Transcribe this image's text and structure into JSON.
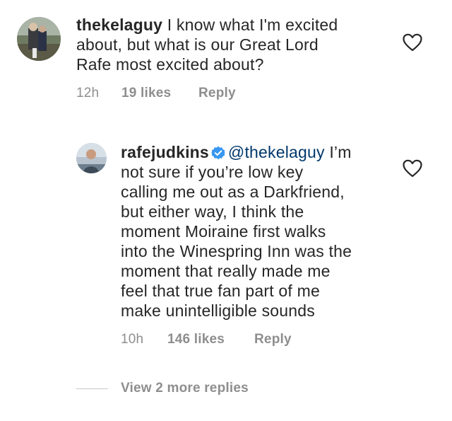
{
  "comment": {
    "username": "thekelaguy",
    "lines": [
      "I know what I'm excited",
      "about, but what is our Great Lord",
      "Rafe most excited about?"
    ],
    "time": "12h",
    "likes": "19 likes",
    "reply": "Reply",
    "avatar_icon": "profile-photo"
  },
  "reply_comment": {
    "username": "rafejudkins",
    "verified_icon": "verified-badge-icon",
    "mention": "@thekelaguy",
    "lines": [
      "I’m",
      "not sure if you’re low key",
      "calling me out as a Darkfriend,",
      "but either way, I think the",
      "moment Moiraine first walks",
      "into the Winespring Inn was the",
      "moment that really made me",
      "feel that true fan part of me",
      "make unintelligible sounds"
    ],
    "time": "10h",
    "likes": "146 likes",
    "reply": "Reply",
    "avatar_icon": "profile-photo"
  },
  "view_more": {
    "label": "View 2 more replies"
  },
  "colors": {
    "text": "#262626",
    "meta": "#8e8e8e",
    "mention": "#00376b",
    "verified": "#3897f0"
  }
}
